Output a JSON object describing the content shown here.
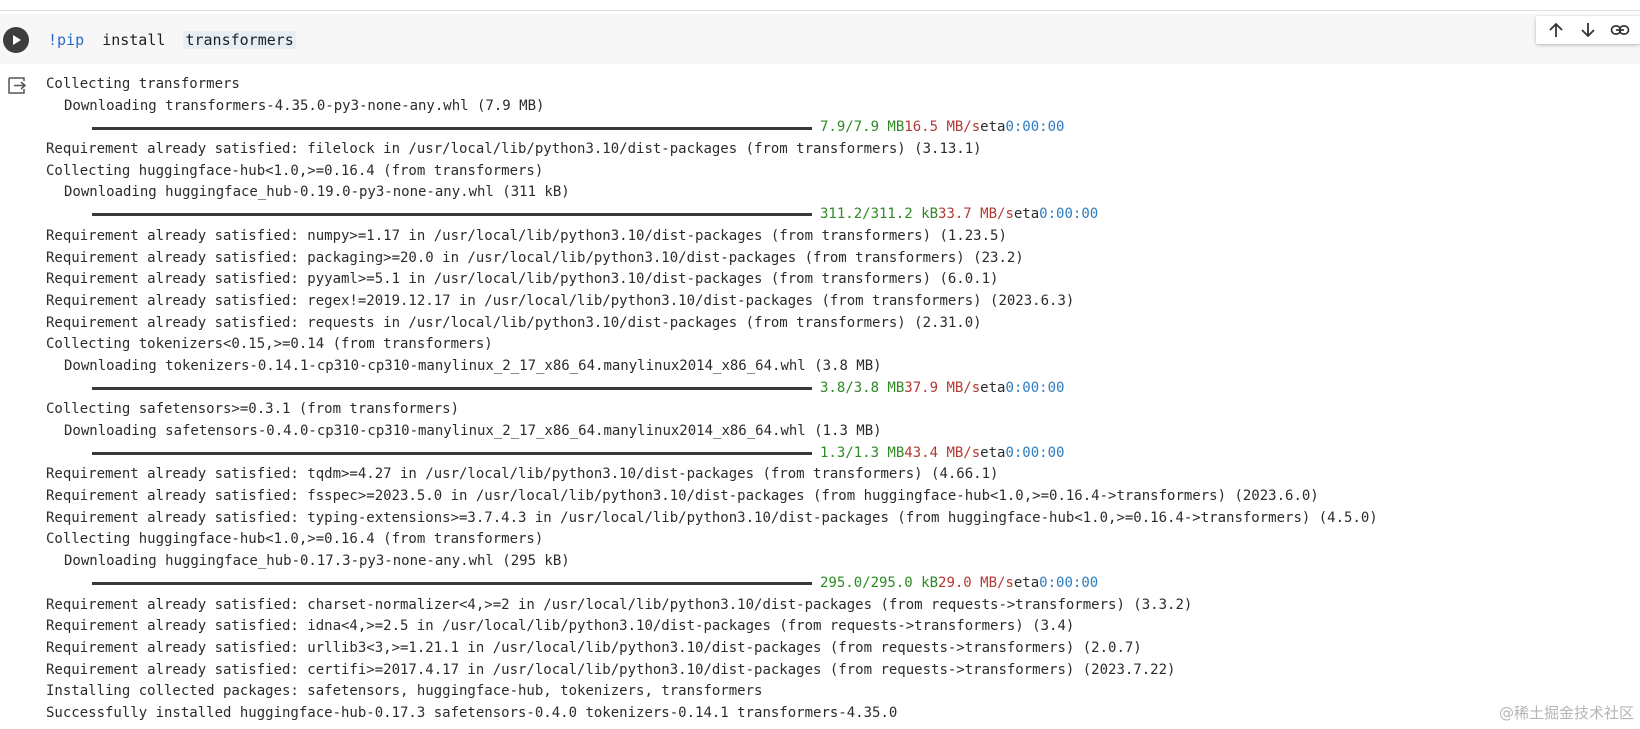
{
  "code_cell": {
    "command_prefix": "!pip",
    "command_mid": "install",
    "command_package": "transformers"
  },
  "toolbar": {
    "icons": [
      "arrow-up-icon",
      "arrow-down-icon",
      "link-icon"
    ]
  },
  "output": {
    "lines": [
      {
        "kind": "text",
        "text": "Collecting transformers"
      },
      {
        "kind": "indent",
        "text": "Downloading transformers-4.35.0-py3-none-any.whl (7.9 MB)"
      },
      {
        "kind": "progress",
        "size": "7.9/7.9 MB",
        "speed": "16.5 MB/s",
        "eta_label": "eta",
        "eta": "0:00:00"
      },
      {
        "kind": "text",
        "text": "Requirement already satisfied: filelock in /usr/local/lib/python3.10/dist-packages (from transformers) (3.13.1)"
      },
      {
        "kind": "text",
        "text": "Collecting huggingface-hub<1.0,>=0.16.4 (from transformers)"
      },
      {
        "kind": "indent",
        "text": "Downloading huggingface_hub-0.19.0-py3-none-any.whl (311 kB)"
      },
      {
        "kind": "progress",
        "size": "311.2/311.2 kB",
        "speed": "33.7 MB/s",
        "eta_label": "eta",
        "eta": "0:00:00"
      },
      {
        "kind": "text",
        "text": "Requirement already satisfied: numpy>=1.17 in /usr/local/lib/python3.10/dist-packages (from transformers) (1.23.5)"
      },
      {
        "kind": "text",
        "text": "Requirement already satisfied: packaging>=20.0 in /usr/local/lib/python3.10/dist-packages (from transformers) (23.2)"
      },
      {
        "kind": "text",
        "text": "Requirement already satisfied: pyyaml>=5.1 in /usr/local/lib/python3.10/dist-packages (from transformers) (6.0.1)"
      },
      {
        "kind": "text",
        "text": "Requirement already satisfied: regex!=2019.12.17 in /usr/local/lib/python3.10/dist-packages (from transformers) (2023.6.3)"
      },
      {
        "kind": "text",
        "text": "Requirement already satisfied: requests in /usr/local/lib/python3.10/dist-packages (from transformers) (2.31.0)"
      },
      {
        "kind": "text",
        "text": "Collecting tokenizers<0.15,>=0.14 (from transformers)"
      },
      {
        "kind": "indent",
        "text": "Downloading tokenizers-0.14.1-cp310-cp310-manylinux_2_17_x86_64.manylinux2014_x86_64.whl (3.8 MB)"
      },
      {
        "kind": "progress",
        "size": "3.8/3.8 MB",
        "speed": "37.9 MB/s",
        "eta_label": "eta",
        "eta": "0:00:00"
      },
      {
        "kind": "text",
        "text": "Collecting safetensors>=0.3.1 (from transformers)"
      },
      {
        "kind": "indent",
        "text": "Downloading safetensors-0.4.0-cp310-cp310-manylinux_2_17_x86_64.manylinux2014_x86_64.whl (1.3 MB)"
      },
      {
        "kind": "progress",
        "size": "1.3/1.3 MB",
        "speed": "43.4 MB/s",
        "eta_label": "eta",
        "eta": "0:00:00"
      },
      {
        "kind": "text",
        "text": "Requirement already satisfied: tqdm>=4.27 in /usr/local/lib/python3.10/dist-packages (from transformers) (4.66.1)"
      },
      {
        "kind": "text",
        "text": "Requirement already satisfied: fsspec>=2023.5.0 in /usr/local/lib/python3.10/dist-packages (from huggingface-hub<1.0,>=0.16.4->transformers) (2023.6.0)"
      },
      {
        "kind": "text",
        "text": "Requirement already satisfied: typing-extensions>=3.7.4.3 in /usr/local/lib/python3.10/dist-packages (from huggingface-hub<1.0,>=0.16.4->transformers) (4.5.0)"
      },
      {
        "kind": "text",
        "text": "Collecting huggingface-hub<1.0,>=0.16.4 (from transformers)"
      },
      {
        "kind": "indent",
        "text": "Downloading huggingface_hub-0.17.3-py3-none-any.whl (295 kB)"
      },
      {
        "kind": "progress",
        "size": "295.0/295.0 kB",
        "speed": "29.0 MB/s",
        "eta_label": "eta",
        "eta": "0:00:00"
      },
      {
        "kind": "text",
        "text": "Requirement already satisfied: charset-normalizer<4,>=2 in /usr/local/lib/python3.10/dist-packages (from requests->transformers) (3.3.2)"
      },
      {
        "kind": "text",
        "text": "Requirement already satisfied: idna<4,>=2.5 in /usr/local/lib/python3.10/dist-packages (from requests->transformers) (3.4)"
      },
      {
        "kind": "text",
        "text": "Requirement already satisfied: urllib3<3,>=1.21.1 in /usr/local/lib/python3.10/dist-packages (from requests->transformers) (2.0.7)"
      },
      {
        "kind": "text",
        "text": "Requirement already satisfied: certifi>=2017.4.17 in /usr/local/lib/python3.10/dist-packages (from requests->transformers) (2023.7.22)"
      },
      {
        "kind": "text",
        "text": "Installing collected packages: safetensors, huggingface-hub, tokenizers, transformers"
      },
      {
        "kind": "text",
        "text": "Successfully installed huggingface-hub-0.17.3 safetensors-0.4.0 tokenizers-0.14.1 transformers-4.35.0"
      }
    ]
  },
  "watermark": "@稀土掘金技术社区",
  "colors": {
    "size": "#2d8a24",
    "speed": "#b23a32",
    "eta": "#2e7bbf",
    "bar": "#3a3a3a"
  }
}
